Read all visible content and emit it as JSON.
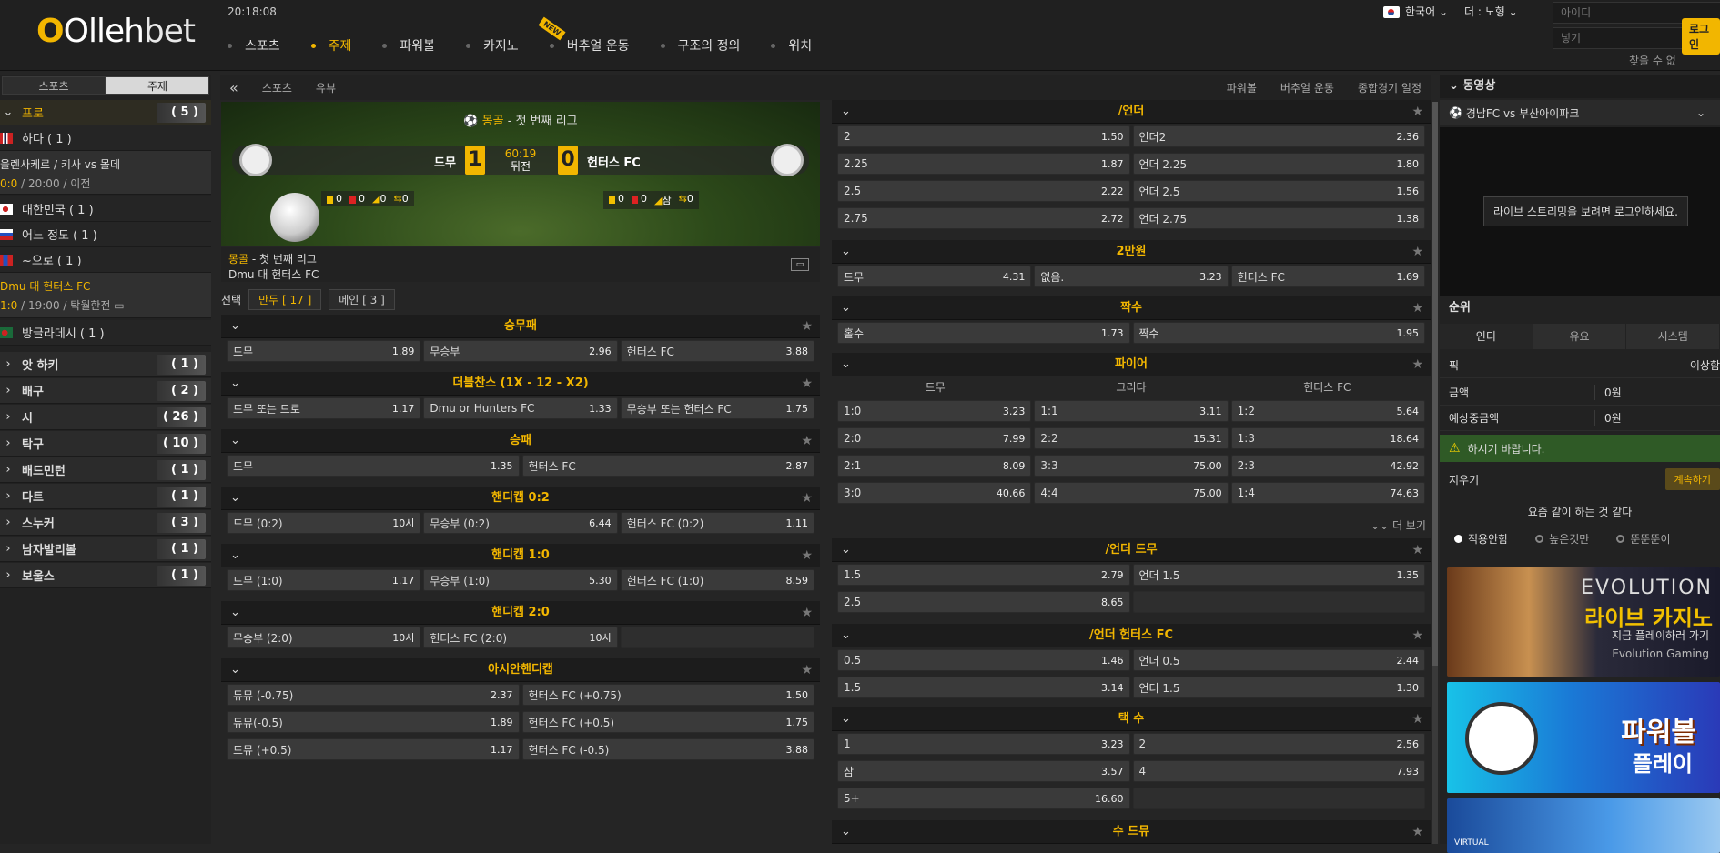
{
  "header": {
    "logo_main": "Olleh",
    "logo_sub": "bet",
    "clock": "20:18:08",
    "nav": [
      {
        "label": "스포츠",
        "active": false
      },
      {
        "label": "주제",
        "active": true
      },
      {
        "label": "파워볼",
        "active": false
      },
      {
        "label": "카지노",
        "active": false,
        "tag": "NEW"
      },
      {
        "label": "버추얼 운동",
        "active": false
      },
      {
        "label": "구조의 정의",
        "active": false
      },
      {
        "label": "위치",
        "active": false
      }
    ],
    "language": "한국어",
    "theme": "더 : 노형",
    "id_placeholder": "아이디",
    "pw_placeholder": "넣기",
    "login_label": "로그인",
    "find_label": "찾을 수 없"
  },
  "left": {
    "tabs": [
      "스포츠",
      "주제"
    ],
    "category_pro": {
      "label": "프로",
      "count": "( 5 )"
    },
    "sub1": "하다 ( 1 )",
    "match1": {
      "title": "올렌사케르 / 키사 vs 몰데",
      "score": "0:0",
      "time": "/ 20:00",
      "status": "/ 이전"
    },
    "sub2": "대한민국 ( 1 )",
    "sub3": "어느 정도 ( 1 )",
    "sub4": "~으로 ( 1 )",
    "match2": {
      "title": "Dmu 대 헌터스 FC",
      "score": "1:0",
      "time": "/ 19:00",
      "status": "/ 탁월한전"
    },
    "sub5": "방글라데시 ( 1 )",
    "sports": [
      {
        "label": "앗 하키",
        "count": "( 1 )"
      },
      {
        "label": "배구",
        "count": "( 2 )"
      },
      {
        "label": "시",
        "count": "( 26 )"
      },
      {
        "label": "탁구",
        "count": "( 10 )"
      },
      {
        "label": "배드민턴",
        "count": "( 1 )"
      },
      {
        "label": "다트",
        "count": "( 1 )"
      },
      {
        "label": "스누커",
        "count": "( 3 )"
      },
      {
        "label": "남자발리볼",
        "count": "( 1 )"
      },
      {
        "label": "보울스",
        "count": "( 1 )"
      }
    ]
  },
  "toolbar": {
    "back": "«",
    "left": [
      "스포츠",
      "유뷰"
    ],
    "right": [
      "파워볼",
      "버추얼 운동",
      "종합경기 일정"
    ]
  },
  "scoreboard": {
    "league_country": "몽골",
    "league_name": " - 첫 번째 리그",
    "home": "드무",
    "away": "헌터스 FC",
    "home_score": "1",
    "away_score": "0",
    "time": "60:19",
    "period": "뒤전",
    "home_stats": [
      "0",
      "0",
      "0",
      "0"
    ],
    "away_stats": [
      "0",
      "0",
      "삼",
      "0"
    ]
  },
  "matchinfo": {
    "country": "몽골",
    "league": " - 첫 번째 리그",
    "teams": "Dmu 대 헌터스 FC",
    "icon": "stats-icon"
  },
  "select": {
    "label": "선택",
    "btn1": "만두 [ 17 ]",
    "btn2": "메인 [ 3 ]"
  },
  "markets_left": [
    {
      "title": "승무패",
      "rows": [
        [
          [
            "드무",
            "1.89"
          ],
          [
            "무승부",
            "2.96"
          ],
          [
            "헌터스 FC",
            "3.88"
          ]
        ]
      ]
    },
    {
      "title": "더블찬스 (1X - 12 - X2)",
      "rows": [
        [
          [
            "드무 또는 드로",
            "1.17"
          ],
          [
            "Dmu or Hunters FC",
            "1.33"
          ],
          [
            "무승부 또는 헌터스 FC",
            "1.75"
          ]
        ]
      ]
    },
    {
      "title": "승패",
      "rows": [
        [
          [
            "드무",
            "1.35"
          ],
          [
            "헌터스 FC",
            "2.87"
          ]
        ]
      ]
    },
    {
      "title": "핸디캡 0:2",
      "rows": [
        [
          [
            "드무 (0:2)",
            "10시"
          ],
          [
            "무승부 (0:2)",
            "6.44"
          ],
          [
            "헌터스 FC (0:2)",
            "1.11"
          ]
        ]
      ]
    },
    {
      "title": "핸디캡 1:0",
      "rows": [
        [
          [
            "드무 (1:0)",
            "1.17"
          ],
          [
            "무승부 (1:0)",
            "5.30"
          ],
          [
            "헌터스 FC (1:0)",
            "8.59"
          ]
        ]
      ]
    },
    {
      "title": "핸디캡 2:0",
      "rows": [
        [
          [
            "무승부 (2:0)",
            "10시"
          ],
          [
            "헌터스 FC (2:0)",
            "10시"
          ],
          [
            "",
            ""
          ]
        ]
      ]
    },
    {
      "title": "아시안핸디캡",
      "rows": [
        [
          [
            "듀뮤 (-0.75)",
            "2.37"
          ],
          [
            "헌터스 FC (+0.75)",
            "1.50"
          ]
        ],
        [
          [
            "듀뮤(-0.5)",
            "1.89"
          ],
          [
            "헌터스 FC (+0.5)",
            "1.75"
          ]
        ],
        [
          [
            "드뮤 (+0.5)",
            "1.17"
          ],
          [
            "헌터스 FC (-0.5)",
            "3.88"
          ]
        ]
      ]
    }
  ],
  "markets_right": {
    "ou": {
      "title": "/언더",
      "rows": [
        [
          [
            "2",
            "1.50"
          ],
          [
            "언더2",
            "2.36"
          ]
        ],
        [
          [
            "2.25",
            "1.87"
          ],
          [
            "언더 2.25",
            "1.80"
          ]
        ],
        [
          [
            "2.5",
            "2.22"
          ],
          [
            "언더 2.5",
            "1.56"
          ]
        ],
        [
          [
            "2.75",
            "2.72"
          ],
          [
            "언더 2.75",
            "1.38"
          ]
        ]
      ]
    },
    "twoway": {
      "title": "2만원",
      "rows": [
        [
          [
            "드무",
            "4.31"
          ],
          [
            "없음.",
            "3.23"
          ],
          [
            "헌터스 FC",
            "1.69"
          ]
        ]
      ]
    },
    "oddeven": {
      "title": "짝수",
      "rows": [
        [
          [
            "홀수",
            "1.73"
          ],
          [
            "짝수",
            "1.95"
          ]
        ]
      ]
    },
    "correct": {
      "title": "파이어",
      "cols": [
        "드무",
        "그리다",
        "헌터스 FC"
      ],
      "rows": [
        [
          [
            "1:0",
            "3.23"
          ],
          [
            "1:1",
            "3.11"
          ],
          [
            "1:2",
            "5.64"
          ]
        ],
        [
          [
            "2:0",
            "7.99"
          ],
          [
            "2:2",
            "15.31"
          ],
          [
            "1:3",
            "18.64"
          ]
        ],
        [
          [
            "2:1",
            "8.09"
          ],
          [
            "3:3",
            "75.00"
          ],
          [
            "2:3",
            "42.92"
          ]
        ],
        [
          [
            "3:0",
            "40.66"
          ],
          [
            "4:4",
            "75.00"
          ],
          [
            "1:4",
            "74.63"
          ]
        ]
      ]
    },
    "more": "더 보기",
    "ouhome": {
      "title": "/언더 드무",
      "rows": [
        [
          [
            "1.5",
            "2.79"
          ],
          [
            "언더 1.5",
            "1.35"
          ]
        ],
        [
          [
            "2.5",
            "8.65"
          ],
          [
            "",
            ""
          ]
        ]
      ]
    },
    "ouaway": {
      "title": "/언더 헌터스 FC",
      "rows": [
        [
          [
            "0.5",
            "1.46"
          ],
          [
            "언더 0.5",
            "2.44"
          ]
        ],
        [
          [
            "1.5",
            "3.14"
          ],
          [
            "언더 1.5",
            "1.30"
          ]
        ]
      ]
    },
    "goals": {
      "title": "택 수",
      "rows": [
        [
          [
            "1",
            "3.23"
          ],
          [
            "2",
            "2.56"
          ]
        ],
        [
          [
            "삼",
            "3.57"
          ],
          [
            "4",
            "7.93"
          ]
        ],
        [
          [
            "5+",
            "16.60"
          ],
          [
            "",
            ""
          ]
        ]
      ]
    },
    "last": {
      "title": "수 드뮤"
    }
  },
  "right": {
    "video_title": "동영상",
    "video_match": "경남FC vs 부산아이파크",
    "video_msg": "라이브 스트리밍을 보려면 로그인하세요.",
    "rank_title": "순위",
    "rank_tabs": [
      "인디",
      "유요",
      "시스템"
    ],
    "pick_k": "픽",
    "pick_v": "이상함",
    "amount_k": "금액",
    "amount_v": "0원",
    "expected_k": "예상중금액",
    "expected_v": "0원",
    "warn": "하시기 바랍니다.",
    "clear": "지우기",
    "continue": "계속하기",
    "pref": "요즘 같이 하는 것 같다",
    "radios": [
      "적용안함",
      "높은것만",
      "뚠뚠뚠이"
    ],
    "ban1": {
      "t1": "EVOLUTION",
      "t2": "라이브 카지노",
      "t3": "지금 플레이하러 가기",
      "t4": "Evolution Gaming"
    },
    "ban2": {
      "t1": "파워볼",
      "t2": "플레이"
    },
    "ban3": {
      "t1": "VIRTUAL"
    }
  },
  "colors": {
    "accent": "#f2b600",
    "bg": "#252525",
    "cell": "#3a3a3a"
  }
}
